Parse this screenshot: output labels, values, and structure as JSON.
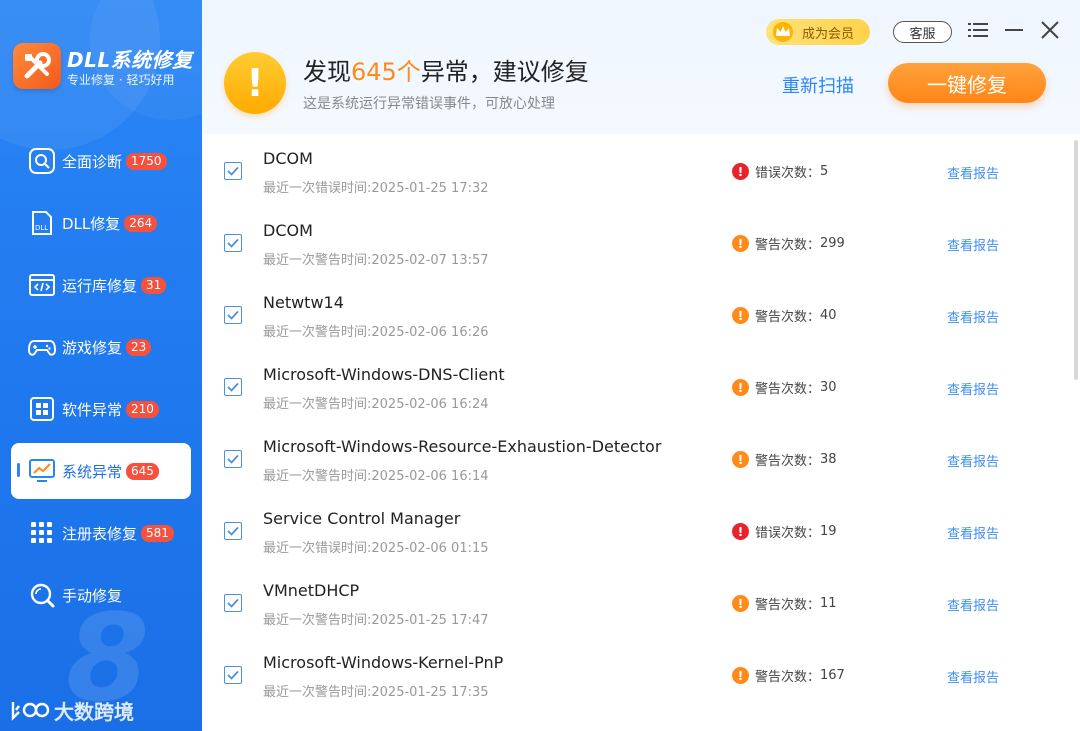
{
  "app": {
    "title": "DLL系统修复",
    "subtitle": "专业修复 · 轻巧好用"
  },
  "sidebar": {
    "items": [
      {
        "label": "全面诊断",
        "badge": "1750",
        "icon": "search-icon"
      },
      {
        "label": "DLL修复",
        "badge": "264",
        "icon": "dll-file-icon"
      },
      {
        "label": "运行库修复",
        "badge": "31",
        "icon": "code-window-icon"
      },
      {
        "label": "游戏修复",
        "badge": "23",
        "icon": "gamepad-icon"
      },
      {
        "label": "软件异常",
        "badge": "210",
        "icon": "app-grid-icon"
      },
      {
        "label": "系统异常",
        "badge": "645",
        "icon": "monitor-chart-icon",
        "active": true
      },
      {
        "label": "注册表修复",
        "badge": "581",
        "icon": "registry-grid-icon"
      },
      {
        "label": "手动修复",
        "badge": "",
        "icon": "magnifier-icon"
      }
    ],
    "watermark": "大数跨境"
  },
  "header": {
    "headline_prefix": "发现",
    "headline_count": "645个",
    "headline_suffix": "异常，建议修复",
    "subline": "这是系统运行异常错误事件，可放心处理",
    "rescan_label": "重新扫描",
    "fix_label": "一键修复",
    "vip_label": "成为会员",
    "service_label": "客服"
  },
  "colors": {
    "accent": "#2a86f5",
    "orange": "#ff8a1a",
    "error": "#e8232e",
    "warning": "#ff8c1a",
    "badge": "#f5513f"
  },
  "list": {
    "report_label": "查看报告",
    "rows": [
      {
        "name": "DCOM",
        "time": "最近一次错误时间:2025-01-25 17:32",
        "type": "error",
        "count_label": "错误次数：",
        "count": "5"
      },
      {
        "name": "DCOM",
        "time": "最近一次警告时间:2025-02-07 13:57",
        "type": "warning",
        "count_label": "警告次数：",
        "count": "299"
      },
      {
        "name": "Netwtw14",
        "time": "最近一次警告时间:2025-02-06 16:26",
        "type": "warning",
        "count_label": "警告次数：",
        "count": "40"
      },
      {
        "name": "Microsoft-Windows-DNS-Client",
        "time": "最近一次警告时间:2025-02-06 16:24",
        "type": "warning",
        "count_label": "警告次数：",
        "count": "30"
      },
      {
        "name": "Microsoft-Windows-Resource-Exhaustion-Detector",
        "time": "最近一次警告时间:2025-02-06 16:14",
        "type": "warning",
        "count_label": "警告次数：",
        "count": "38"
      },
      {
        "name": "Service Control Manager",
        "time": "最近一次错误时间:2025-02-06 01:15",
        "type": "error",
        "count_label": "错误次数：",
        "count": "19"
      },
      {
        "name": "VMnetDHCP",
        "time": "最近一次警告时间:2025-01-25 17:47",
        "type": "warning",
        "count_label": "警告次数：",
        "count": "11"
      },
      {
        "name": "Microsoft-Windows-Kernel-PnP",
        "time": "最近一次警告时间:2025-01-25 17:35",
        "type": "warning",
        "count_label": "警告次数：",
        "count": "167"
      }
    ]
  }
}
